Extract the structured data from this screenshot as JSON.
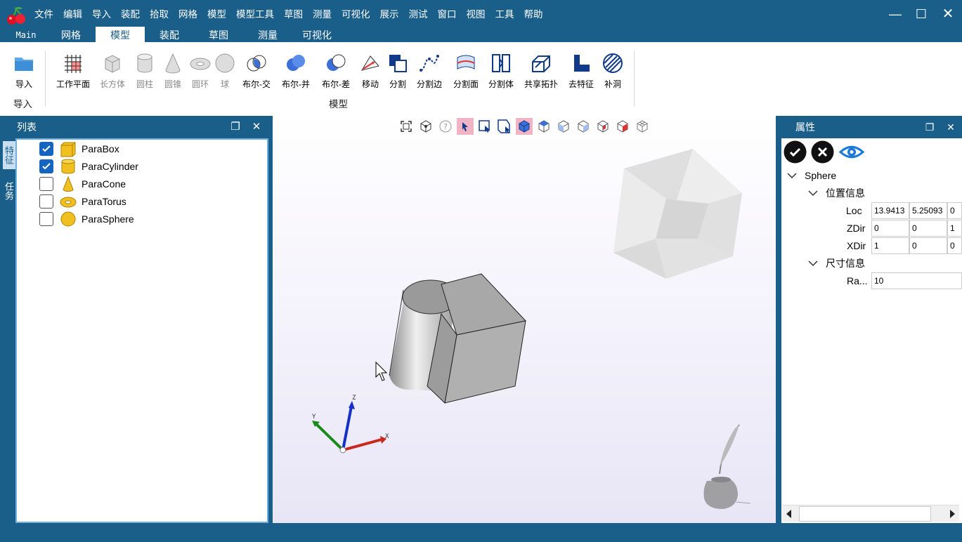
{
  "menu": [
    "文件",
    "编辑",
    "导入",
    "装配",
    "拾取",
    "网格",
    "模型",
    "模型工具",
    "草图",
    "测量",
    "可视化",
    "展示",
    "测试",
    "窗口",
    "视图",
    "工具",
    "帮助"
  ],
  "tabs": [
    "Main",
    "网格",
    "模型",
    "装配",
    "草图",
    "测量",
    "可视化"
  ],
  "active_tab": "模型",
  "ribbon": {
    "import_group": {
      "button": "导入",
      "label": "导入"
    },
    "model_group": {
      "label": "模型",
      "buttons": [
        {
          "label": "工作平面",
          "icon": "grid-plane-icon",
          "enabled": true
        },
        {
          "label": "长方体",
          "icon": "box-icon",
          "enabled": false
        },
        {
          "label": "圆柱",
          "icon": "cylinder-icon",
          "enabled": false
        },
        {
          "label": "圆锥",
          "icon": "cone-icon",
          "enabled": false
        },
        {
          "label": "圆环",
          "icon": "torus-icon",
          "enabled": false
        },
        {
          "label": "球",
          "icon": "sphere-icon",
          "enabled": false
        },
        {
          "label": "布尔-交",
          "icon": "bool-intersect-icon",
          "enabled": true
        },
        {
          "label": "布尔-并",
          "icon": "bool-union-icon",
          "enabled": true
        },
        {
          "label": "布尔-差",
          "icon": "bool-subtract-icon",
          "enabled": true
        },
        {
          "label": "移动",
          "icon": "move-icon",
          "enabled": true
        },
        {
          "label": "分割",
          "icon": "split-icon",
          "enabled": true
        },
        {
          "label": "分割边",
          "icon": "split-edge-icon",
          "enabled": true
        },
        {
          "label": "分割面",
          "icon": "split-face-icon",
          "enabled": true
        },
        {
          "label": "分割体",
          "icon": "split-body-icon",
          "enabled": true
        },
        {
          "label": "共享拓扑",
          "icon": "shared-topology-icon",
          "enabled": true
        },
        {
          "label": "去特征",
          "icon": "defeature-icon",
          "enabled": true
        },
        {
          "label": "补洞",
          "icon": "fill-hole-icon",
          "enabled": true
        }
      ]
    }
  },
  "left_panel": {
    "title": "列表",
    "side_tabs": [
      "特征",
      "任务"
    ],
    "items": [
      {
        "label": "ParaBox",
        "checked": true,
        "icon": "box-icon"
      },
      {
        "label": "ParaCylinder",
        "checked": true,
        "icon": "cylinder-icon"
      },
      {
        "label": "ParaCone",
        "checked": false,
        "icon": "cone-icon"
      },
      {
        "label": "ParaTorus",
        "checked": false,
        "icon": "torus-icon"
      },
      {
        "label": "ParaSphere",
        "checked": false,
        "icon": "sphere-icon"
      }
    ]
  },
  "viewport": {
    "axes": {
      "x": "X",
      "y": "Y",
      "z": "Z"
    }
  },
  "right_panel": {
    "title": "属性",
    "object": "Sphere",
    "sections": {
      "position": "位置信息",
      "size": "尺寸信息"
    },
    "rows": {
      "loc": {
        "label": "Loc",
        "values": [
          "13.9413",
          "5.25093",
          "0"
        ]
      },
      "zdir": {
        "label": "ZDir",
        "values": [
          "0",
          "0",
          "1"
        ]
      },
      "xdir": {
        "label": "XDir",
        "values": [
          "1",
          "0",
          "0"
        ]
      },
      "radius": {
        "label": "Ra...",
        "value": "10"
      }
    }
  },
  "colors": {
    "accent": "#1a5e8a",
    "check": "#1565c0",
    "selection": "#f0b4c4"
  }
}
